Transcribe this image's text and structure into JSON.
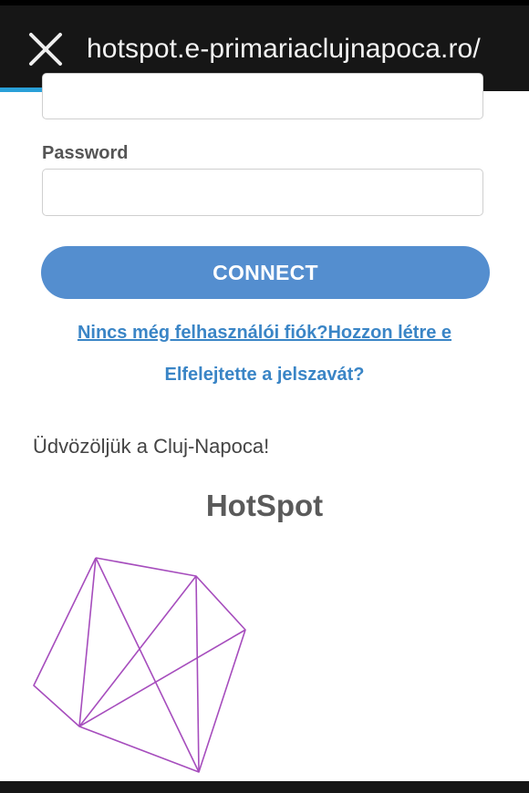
{
  "browser": {
    "url": "hotspot.e-primariaclujnapoca.ro/",
    "close_icon": "close-icon",
    "progress_percent": 22
  },
  "form": {
    "password_label": "Password",
    "password_value": "",
    "username_value": "",
    "connect_label": "CONNECT",
    "register_link": "Nincs még felhasználói fiók?Hozzon létre e",
    "forgot_link": "Elfelejtette a jelszavát?"
  },
  "content": {
    "welcome_text": "Üdvözöljük a Cluj-Napoca!",
    "hotspot_heading": "HotSpot",
    "logo_icon": "geometric-wireframe-logo",
    "logo_color": "#a64dbd"
  },
  "colors": {
    "accent": "#548ecf",
    "link": "#3a85c6",
    "bar": "#161616"
  }
}
